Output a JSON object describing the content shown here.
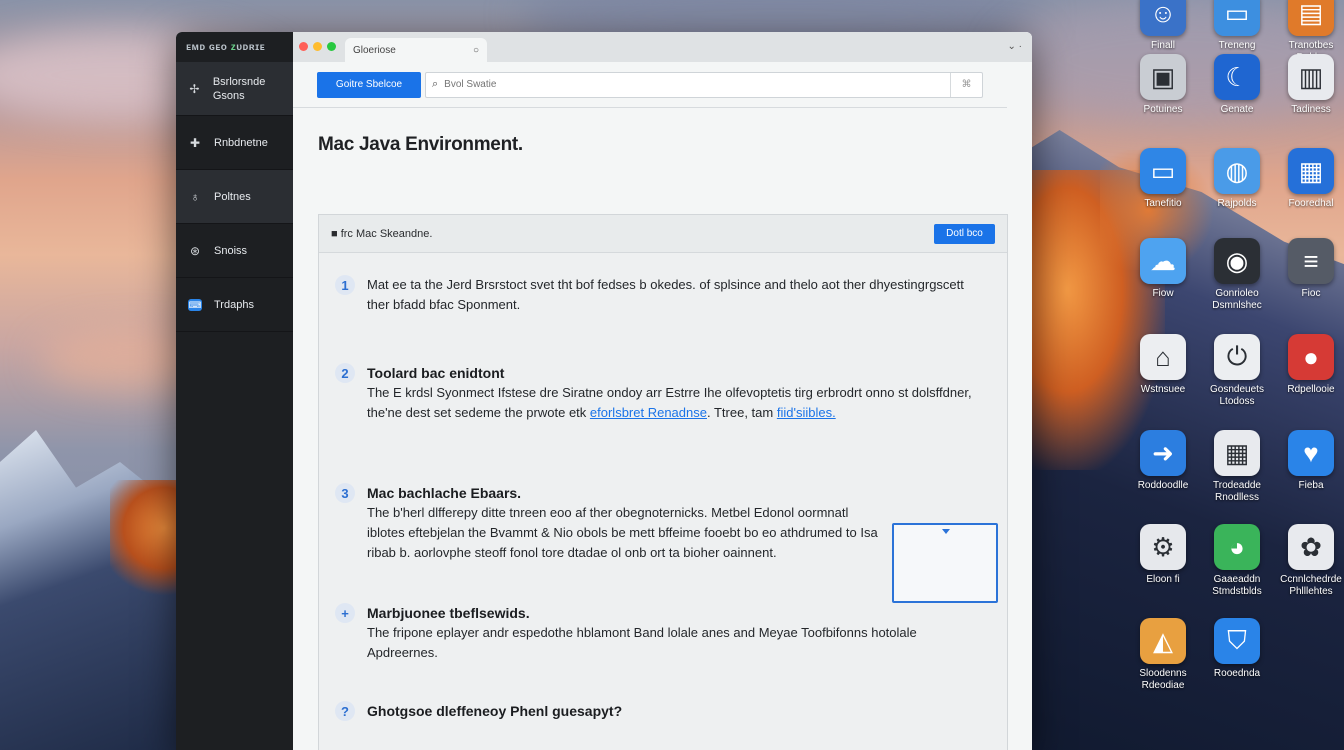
{
  "desktop": {
    "icons": [
      {
        "label": "Finall",
        "icon": "finder-icon",
        "color": "#3a72c8"
      },
      {
        "label": "Treneng",
        "icon": "window-icon",
        "color": "#3d8fe0"
      },
      {
        "label": "Tranotbes Dubbs",
        "icon": "folder-icon",
        "color": "#e07a2a"
      },
      {
        "label": "Potuines",
        "icon": "box-icon",
        "color": "#c9cdd3"
      },
      {
        "label": "Genate",
        "icon": "moon-icon",
        "color": "#1f66d1"
      },
      {
        "label": "Tadiness",
        "icon": "ruler-icon",
        "color": "#e8eaee"
      },
      {
        "label": "Tanefitio",
        "icon": "monitor-icon",
        "color": "#2f86e6"
      },
      {
        "label": "Rajpolds",
        "icon": "globe-icon",
        "color": "#4a9be8"
      },
      {
        "label": "Fooredhal",
        "icon": "device-icon",
        "color": "#2570d9"
      },
      {
        "label": "Fiow",
        "icon": "cloud-icon",
        "color": "#4ea3f0"
      },
      {
        "label": "Gonrioleo Dsmnlshec",
        "icon": "disc-icon",
        "color": "#2b2f35"
      },
      {
        "label": "Fioc",
        "icon": "stack-icon",
        "color": "#555b66"
      },
      {
        "label": "Wstnsuee",
        "icon": "lock-icon",
        "color": "#eceef1"
      },
      {
        "label": "Gosndeuets Ltodoss",
        "icon": "power-icon",
        "color": "#eceef1"
      },
      {
        "label": "Rdpellooie",
        "icon": "apple-icon",
        "color": "#d63a35"
      },
      {
        "label": "Roddoodlle",
        "icon": "arrow-icon",
        "color": "#2c7ee0"
      },
      {
        "label": "Trodeadde Rnodlless",
        "icon": "calendar-icon",
        "color": "#e8eaee"
      },
      {
        "label": "Fieba",
        "icon": "drop-icon",
        "color": "#2a84e8"
      },
      {
        "label": "Eloon fi",
        "icon": "tool-icon",
        "color": "#e6e8ec"
      },
      {
        "label": "Gaaeaddn Stmdstblds",
        "icon": "chrome-icon",
        "color": "#3ab45a"
      },
      {
        "label": "Ccnnlchedrde Phlllehtes",
        "icon": "photos-icon",
        "color": "#e8eaee"
      },
      {
        "label": "Sloodenns Rdeodiae",
        "icon": "shape-icon",
        "color": "#e8a040"
      },
      {
        "label": "Rooednda",
        "icon": "shield-icon",
        "color": "#2a84e8"
      }
    ]
  },
  "window": {
    "sidebar": {
      "brand_prefix": "ᴇᴍᴅ ɢᴇᴏ",
      "brand_accent": "ᴢ",
      "brand_suffix": "ᴜᴅʀɪᴇ",
      "items": [
        {
          "icon": "gear-icon",
          "glyph": "✢",
          "label": "Bsrlorsnde Gsons"
        },
        {
          "icon": "plus-icon",
          "glyph": "✚",
          "label": "Rnbdnetne"
        },
        {
          "icon": "bell-icon",
          "glyph": "♁",
          "label": "Poltnes"
        },
        {
          "icon": "chat-icon",
          "glyph": "⊛",
          "label": "Snoiss"
        },
        {
          "icon": "terminal-icon",
          "glyph": "⌨",
          "label": "Trdaphs"
        }
      ]
    },
    "tab": {
      "title": "Gloeriose",
      "close": "○"
    },
    "tab_menu": "⌄ ·",
    "toolbar": {
      "button_label": "Goitre Sbelcoe",
      "search_placeholder": "Bvol Swatie",
      "search_icon": "search-icon",
      "kbd_hint": "⌘"
    },
    "page_title": "Mac Java Environment.",
    "card": {
      "header_label": "■ frc Mac Skeandne.",
      "header_button": "Dotl bco",
      "steps": [
        {
          "num": "1",
          "heading": "",
          "body": "Mat ee ta the Jerd Brsrstoct svet tht bof fedses b okedes. of splsince and thelo aot ther dhyestingrgscett ther bfadd bfac Sponment.",
          "link": ""
        },
        {
          "num": "2",
          "heading": "Toolard bac enidtont",
          "body": "The E krdsl Syonmect Ifstese dre Siratne ondoy arr Estrre Ihe olfevoptetis tirg erbrodrt onno st dolsffdner, the'ne dest set sedeme the prwote etk",
          "link": "eforlsbret Renadnse",
          "body_tail": ". Ttree, tam",
          "link2": "fiid'siibles."
        },
        {
          "num": "3",
          "heading": "Mac bachlache Ebaars.",
          "body": "The b'herl dlfferepy ditte tnreen eoo af ther obegnoternicks. Metbel Edonol oormnatl iblotes eftebjelan the Bvammt & Nio obols be mett bffeime fooebt bo eo athdrumed to Isa ribab b. aorlovphe steoff fonol tore dtadae ol onb ort ta bioher oainnent."
        },
        {
          "num": "+",
          "heading": "Marbjuonee tbeflsewids.",
          "body": "The fripone eplayer andr espedothe hblamont Band lolale anes and Meyae Toofbifonns hotolale Apdreernes."
        },
        {
          "num": "?",
          "heading": "Ghotgsoe dleffeneoy Phenl guesapyt?",
          "body": ""
        }
      ]
    }
  },
  "colors": {
    "accent": "#1a73e8",
    "sidebar_bg": "#1d1f22",
    "traffic_red": "#ff5f57",
    "traffic_yellow": "#febc2e",
    "traffic_green": "#28c840"
  }
}
